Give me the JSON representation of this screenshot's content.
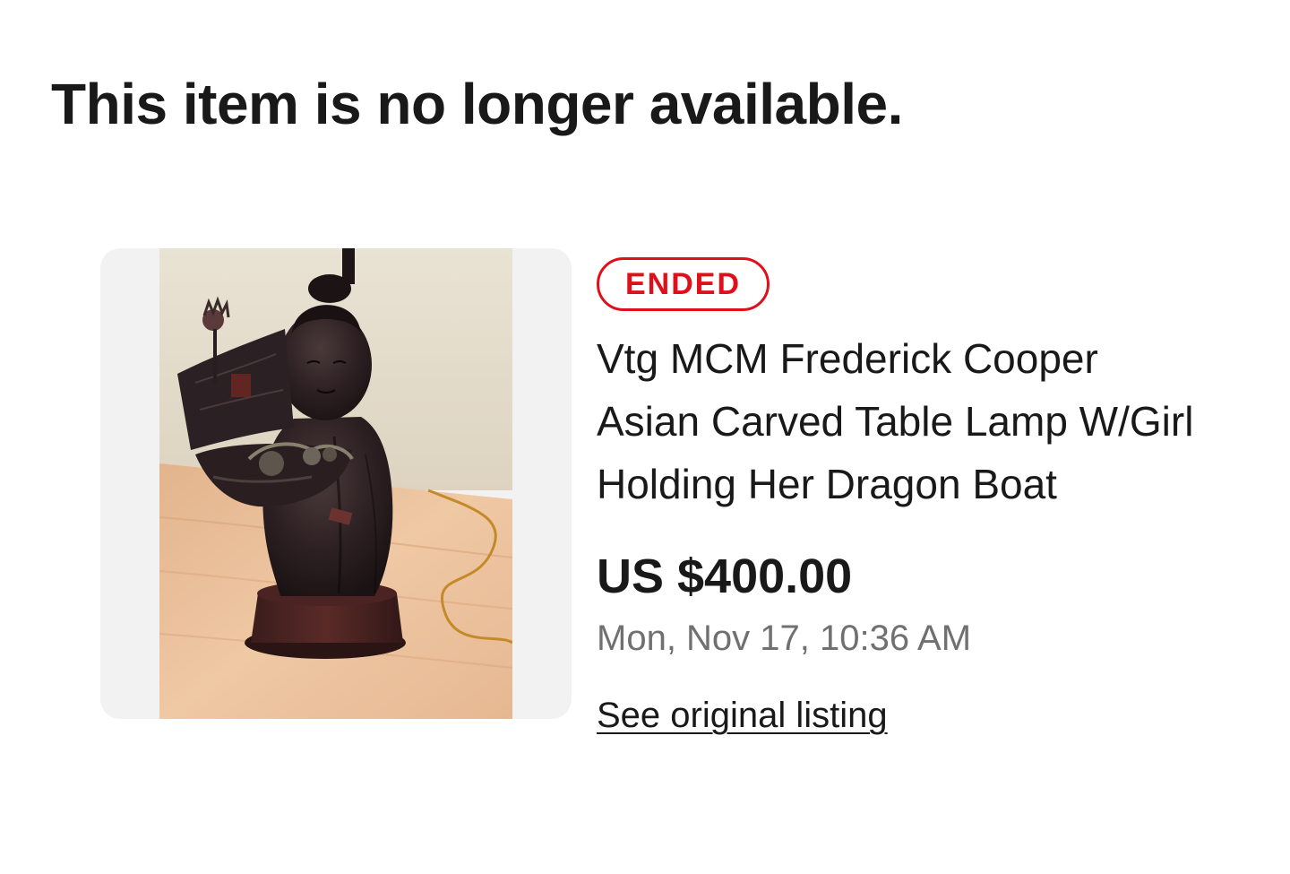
{
  "page": {
    "headline": "This item is no longer available."
  },
  "item": {
    "image_alt": "Vtg MCM Frederick Cooper Asian Carved Table Lamp W/Girl Holding Her Dragon Boat",
    "status": "ENDED",
    "status_color": "#e0101b",
    "title": "Vtg MCM Frederick Cooper Asian Carved Table Lamp W/Girl Holding Her Dragon Boat",
    "price": "US $400.00",
    "end_date": "Mon, Nov 17, 10:36 AM",
    "link_label": "See original listing"
  }
}
